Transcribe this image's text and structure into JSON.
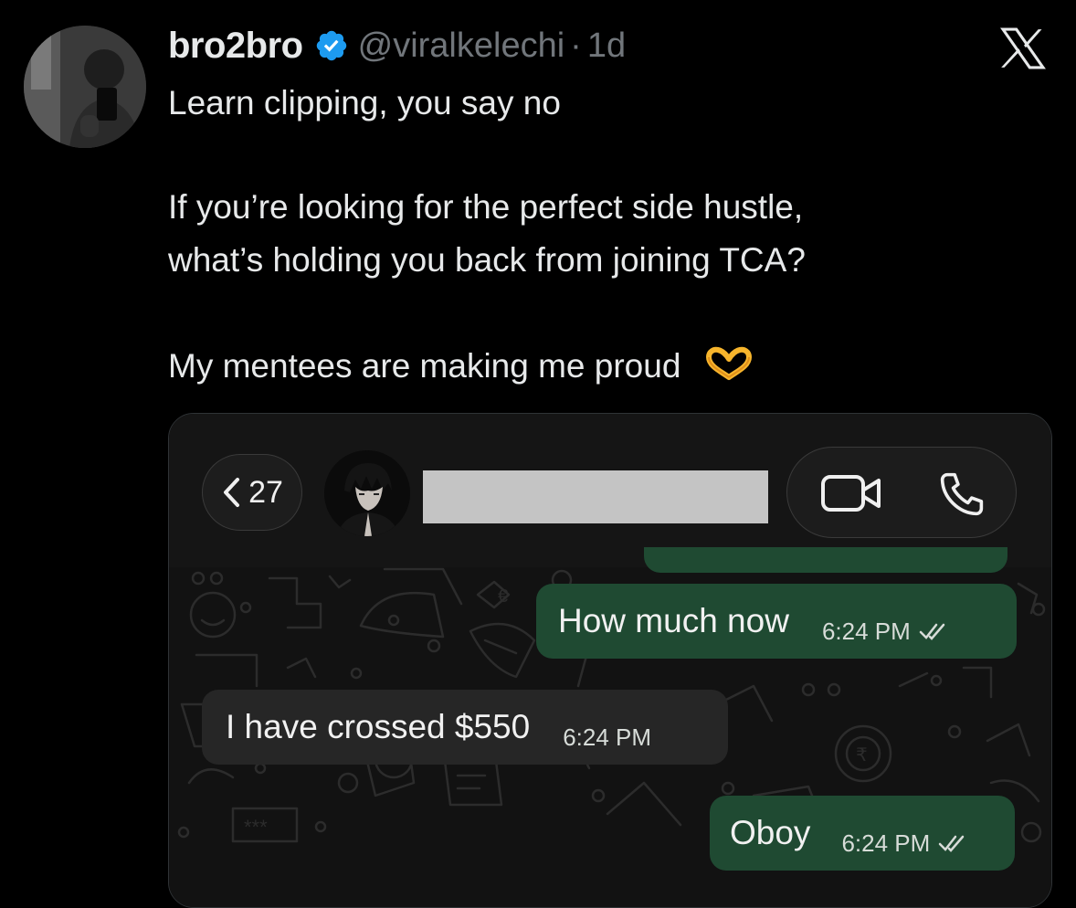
{
  "tweet": {
    "author_name": "bro2bro",
    "handle": "@viralkelechi",
    "separator": "·",
    "time_ago": "1d",
    "lines": [
      "Learn clipping, you say no",
      "If you’re looking for the perfect side hustle,",
      "what’s holding you back from joining TCA?",
      "My mentees are making me proud"
    ],
    "emoji": "heart-hands-icon",
    "colors": {
      "background": "#000000",
      "text": "#e7e9ea",
      "muted": "#71767b",
      "verified": "#1d9bf0"
    }
  },
  "platform_logo": "x-logo-icon",
  "chat": {
    "back_count": "27",
    "contact_name_redacted": true,
    "messages": [
      {
        "direction": "outgoing",
        "text": "How much now",
        "time": "6:24 PM",
        "status": "read"
      },
      {
        "direction": "incoming",
        "text": "I have crossed $550",
        "time": "6:24 PM"
      },
      {
        "direction": "outgoing",
        "text": "Oboy",
        "time": "6:24 PM",
        "status": "read"
      }
    ],
    "colors": {
      "outgoing_bubble": "#1f4a32",
      "incoming_bubble": "#262626",
      "chat_background": "#121212"
    }
  }
}
